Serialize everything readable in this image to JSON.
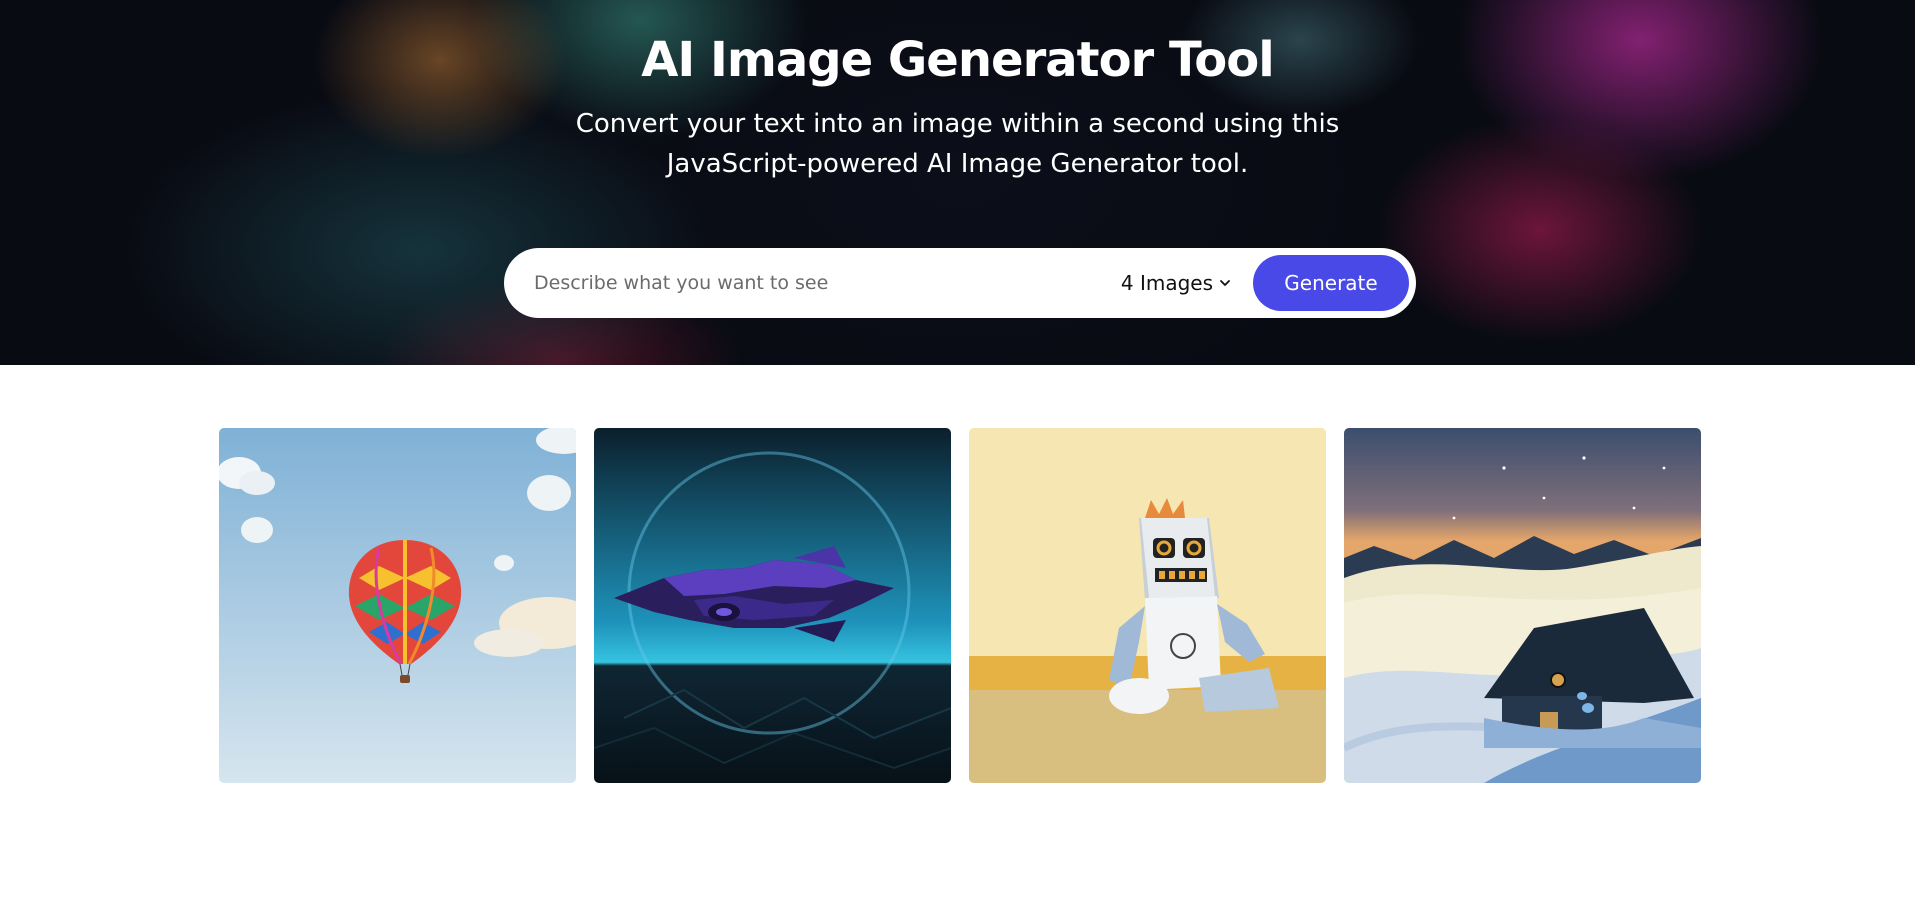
{
  "hero": {
    "title": "AI Image Generator Tool",
    "subtitle_line1": "Convert your text into an image within a second using this",
    "subtitle_line2": "JavaScript-powered AI Image Generator tool."
  },
  "search": {
    "placeholder": "Describe what you want to see",
    "image_count": "4 Images",
    "generate_label": "Generate",
    "accent_color": "#4949e7"
  },
  "gallery": {
    "images": [
      {
        "subject": "hot-air-balloon",
        "background_color": "#a9c9e0"
      },
      {
        "subject": "spaceship",
        "background_color": "#1b7a9e"
      },
      {
        "subject": "plush-robot",
        "background_color": "#f3e1a6"
      },
      {
        "subject": "snowy-cabin",
        "background_color": "#eae4c6"
      }
    ]
  }
}
